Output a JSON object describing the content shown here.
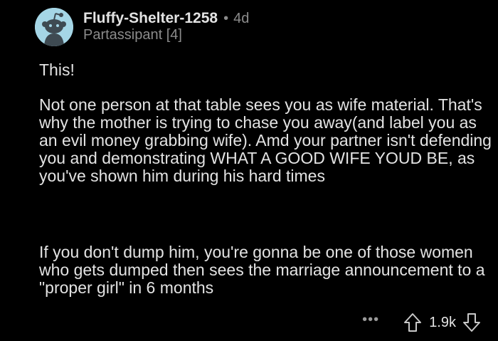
{
  "comment": {
    "author": "Fluffy-Shelter-1258",
    "separator": "•",
    "age": "4d",
    "flair": "Partassipant [4]",
    "avatar_icon": "snoo-avatar-icon",
    "avatar_bg": "#a5d6e6",
    "paragraphs": [
      "This!",
      "Not one person at that table sees you as wife material. That's why the mother is trying to chase you away(and label you as an evil money grabbing wife). Amd your partner isn't defending you and demonstrating WHAT A GOOD WIFE YOUD BE, as you've shown him during his hard times",
      "If you don't dump him, you're gonna be one of those women who gets dumped then sees the marriage announcement to a \"proper girl\" in 6 months"
    ]
  },
  "actions": {
    "more_label": "•••",
    "score": "1.9k",
    "upvote_icon": "upvote-arrow-icon",
    "downvote_icon": "downvote-arrow-icon"
  }
}
